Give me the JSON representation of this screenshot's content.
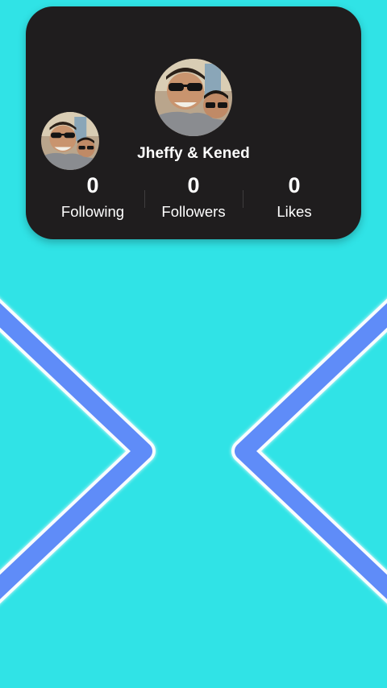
{
  "profile": {
    "name": "Jheffy & Kened",
    "stats": {
      "following": {
        "value": "0",
        "label": "Following"
      },
      "followers": {
        "value": "0",
        "label": "Followers"
      },
      "likes": {
        "value": "0",
        "label": "Likes"
      }
    }
  },
  "colors": {
    "background": "#30e3e6",
    "card": "#1f1d1e",
    "chevron": "#5e8cf8",
    "text": "#ffffff"
  },
  "icons": {
    "left_decoration": "chevron-right-icon",
    "right_decoration": "chevron-left-icon"
  }
}
